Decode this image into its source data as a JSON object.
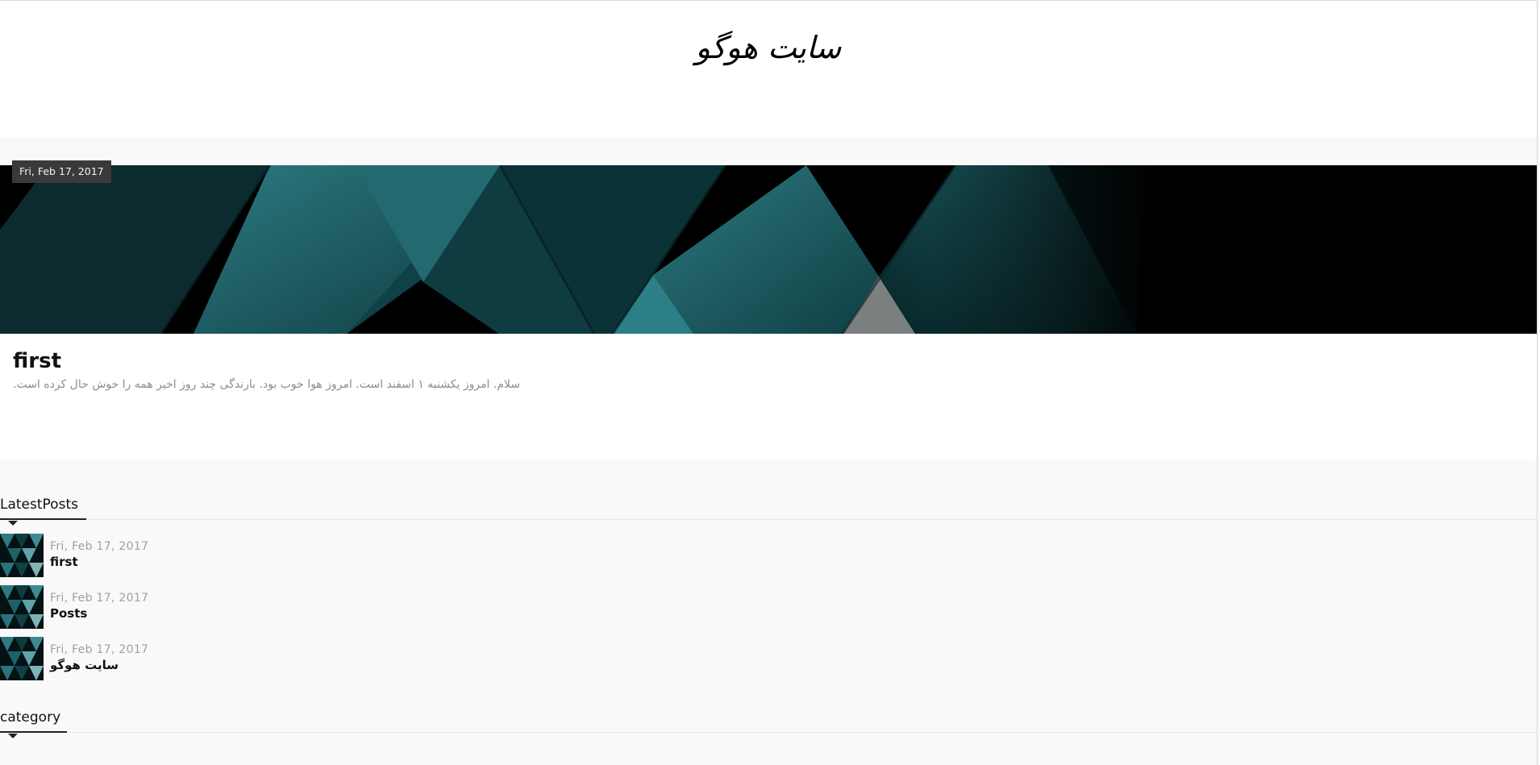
{
  "site": {
    "title": "سایت هوگو"
  },
  "featured_post": {
    "date": "Fri, Feb 17, 2017",
    "title": "first",
    "excerpt": "سلام. امروز یکشنبه ۱ اسفند است. امروز هوا خوب بود. بارندگی چند روز اخیر همه را خوش حال کرده است."
  },
  "latest_posts": {
    "heading": "LatestPosts",
    "items": [
      {
        "date": "Fri, Feb 17, 2017",
        "title": "first"
      },
      {
        "date": "Fri, Feb 17, 2017",
        "title": "Posts"
      },
      {
        "date": "Fri, Feb 17, 2017",
        "title": "سایت هوگو"
      }
    ]
  },
  "category": {
    "heading": "category"
  },
  "colors": {
    "teal": "#2f7f86",
    "teal_dark": "#0d3a3f",
    "badge_bg": "#3a3a3a",
    "page_bg": "#f9f9f9"
  }
}
